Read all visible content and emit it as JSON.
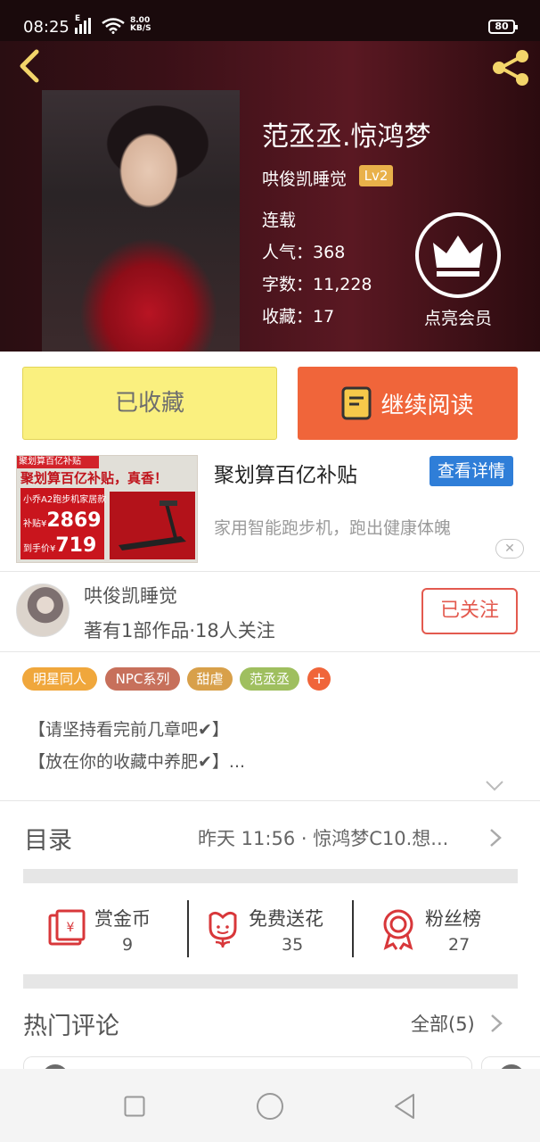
{
  "status_bar": {
    "time": "08:25",
    "net_speed_value": "8.00",
    "net_speed_unit": "KB/S",
    "battery": "80",
    "signal_type": "E"
  },
  "book": {
    "title": "范丞丞.惊鸿梦",
    "author": "哄俊凯睡觉",
    "level": "Lv2",
    "status": "连载",
    "popularity_label": "人气：",
    "popularity": "368",
    "words_label": "字数：",
    "words": "11,228",
    "favorites_label": "收藏：",
    "favorites": "17"
  },
  "vip": {
    "label": "点亮会员"
  },
  "actions": {
    "collected_label": "已收藏",
    "continue_label": "继续阅读"
  },
  "ad": {
    "title": "聚划算百亿补贴",
    "more_label": "查看详情",
    "description": "家用智能跑步机，跑出健康体魄",
    "close_label": "✕",
    "image_banner": "聚划算百亿补贴",
    "image_headline": "聚划算百亿补贴，真香！",
    "image_product": "小乔A2跑步机家居款",
    "image_subsidy_label": "补贴¥",
    "image_subsidy": "2869",
    "image_final_label": "到手价¥",
    "image_final": "719"
  },
  "author_row": {
    "name": "哄俊凯睡觉",
    "meta": "著有1部作品·18人关注",
    "follow_label": "已关注"
  },
  "tags": [
    {
      "label": "明星同人",
      "color": "#f0a73c"
    },
    {
      "label": "NPC系列",
      "color": "#c7705b"
    },
    {
      "label": "甜虐",
      "color": "#d8a04a"
    },
    {
      "label": "范丞丞",
      "color": "#9fbf5f"
    }
  ],
  "tag_add_label": "+",
  "description": {
    "line1": "【请坚持看完前几章吧✔】",
    "line2": "【放在你的收藏中养肥✔】..."
  },
  "toc": {
    "title": "目录",
    "latest": "昨天 11:56 · 惊鸿梦C10.想..."
  },
  "stats": [
    {
      "label": "赏金币",
      "value": "9",
      "icon": "red-envelope-icon"
    },
    {
      "label": "免费送花",
      "value": "35",
      "icon": "flower-icon"
    },
    {
      "label": "粉丝榜",
      "value": "27",
      "icon": "medal-icon"
    }
  ],
  "comments": {
    "title": "热门评论",
    "all_label": "全部(5)"
  },
  "colors": {
    "accent": "#f0653a",
    "collected_bg": "#faf07f",
    "link_blue": "#2f7ed8",
    "follow_red": "#e35a4f"
  }
}
